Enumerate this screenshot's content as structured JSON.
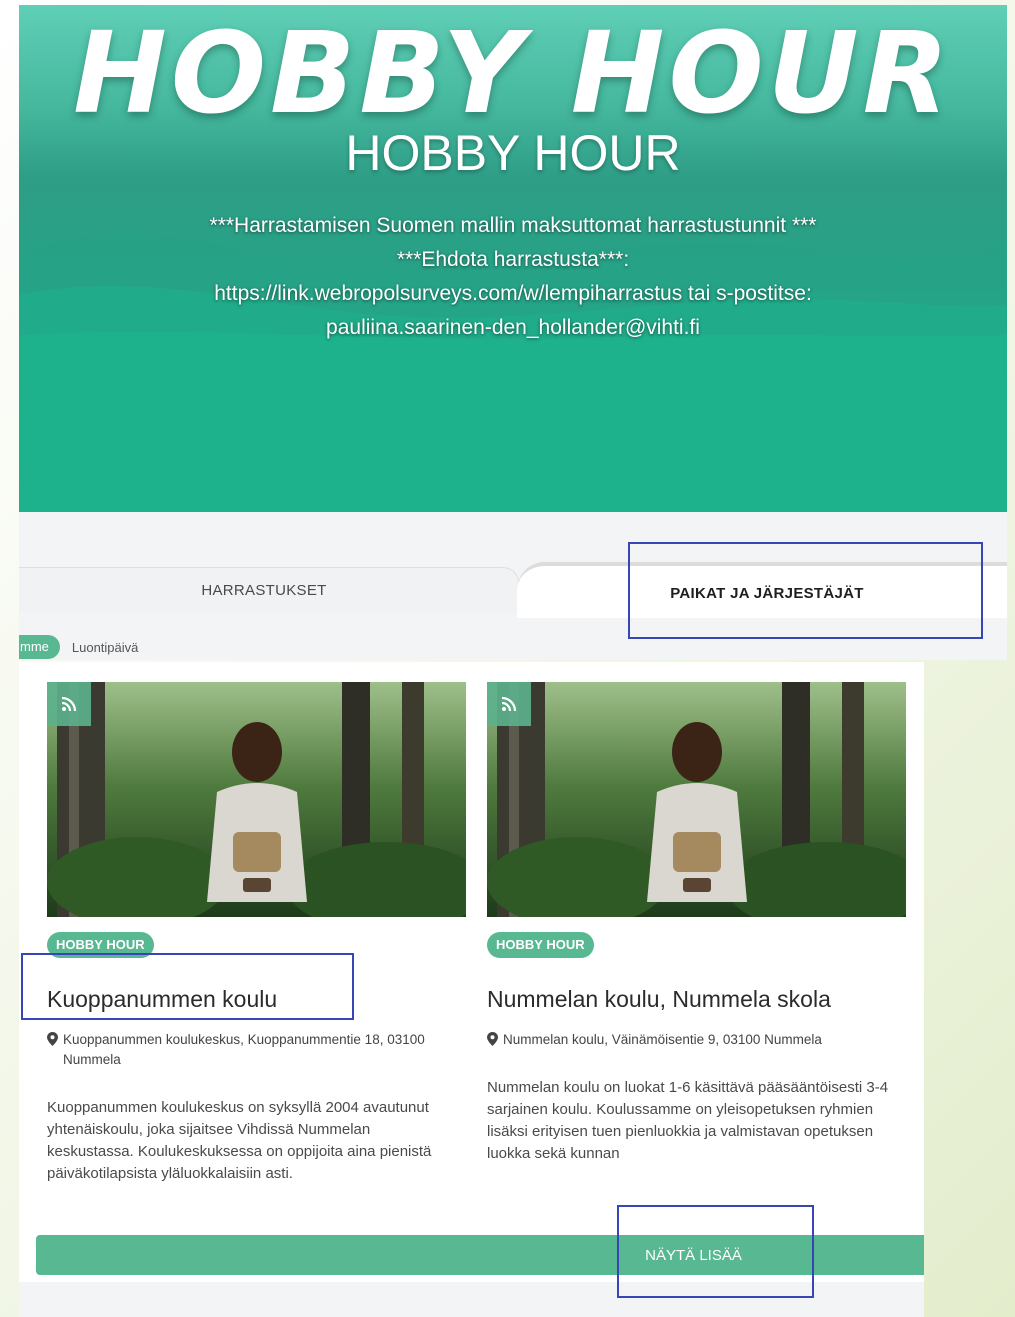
{
  "hero": {
    "logo_text": "HOBBY HOUR",
    "title": "HOBBY HOUR",
    "lines": [
      "***Harrastamisen Suomen mallin maksuttomat harrastustunnit ***",
      "***Ehdota harrastusta***:",
      "https://link.webropolsurveys.com/w/lempiharrastus tai s-postitse:",
      "pauliina.saarinen-den_hollander@vihti.fi"
    ]
  },
  "tabs": [
    {
      "label": "HARRASTUKSET",
      "active": false
    },
    {
      "label": "PAIKAT JA JÄRJESTÄJÄT",
      "active": true
    }
  ],
  "filters": {
    "chip_label": "mme",
    "sort_label": "Luontipäivä"
  },
  "cards": [
    {
      "tag": "HOBBY HOUR",
      "title": "Kuoppanummen koulu",
      "address": "Kuoppanummen koulukeskus, Kuoppanummentie 18, 03100 Nummela",
      "description": "Kuoppanummen koulukeskus on syksyllä 2004 avautunut yhtenäiskoulu, joka sijaitsee Vihdissä Nummelan keskustassa. Koulukeskuksessa on oppijoita aina pienistä päiväkotilapsista yläluokkalaisiin asti."
    },
    {
      "tag": "HOBBY HOUR",
      "title": "Nummelan koulu, Nummela skola",
      "address": "Nummelan koulu, Väinämöisentie 9, 03100 Nummela",
      "description": "Nummelan koulu on luokat 1-6 käsittävä pääsääntöisesti 3-4 sarjainen koulu. Koulussamme on yleisopetuksen ryhmien lisäksi erityisen tuen pienluokkia ja valmistavan opetuksen luokka sekä kunnan"
    }
  ],
  "show_more_label": "NÄYTÄ LISÄÄ",
  "icons": {
    "card_badge": "rss-icon",
    "address": "map-pin-icon"
  },
  "colors": {
    "accent": "#57b892",
    "hero": "#1db28c",
    "highlight": "#3845b5"
  }
}
